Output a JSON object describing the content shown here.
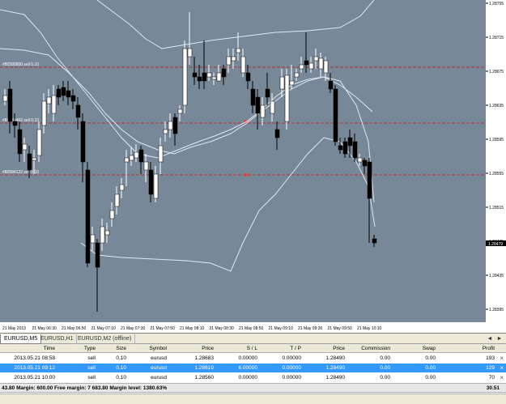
{
  "chart": {
    "background": "#778899",
    "candle_up": "#ffffff",
    "candle_down": "#000000",
    "band_color": "#e0e8f0",
    "order_line_color": "#b03030",
    "price_labels": [
      "1.28755",
      "1.28715",
      "1.28675",
      "1.28635",
      "1.28595",
      "1.28555",
      "1.28515",
      "1.28475",
      "1.28435",
      "1.28395"
    ],
    "current_price": "1.28479",
    "order_labels": [
      {
        "label": "#80580860 sell 0.10"
      },
      {
        "label": "#80584462 sell 0.10"
      },
      {
        "label": "#80584122 sell 0.10"
      }
    ],
    "time_labels": [
      "21 May 2013",
      "21 May 06:30",
      "21 May 06:50",
      "21 May 07:10",
      "21 May 07:30",
      "21 May 07:50",
      "21 May 08:10",
      "21 May 08:30",
      "21 May 08:50",
      "21 May 09:10",
      "21 May 09:30",
      "21 May 09:50",
      "21 May 10:10"
    ]
  },
  "tabs": [
    {
      "label": "EURUSD,M5"
    },
    {
      "label": "EURUSD,H1"
    },
    {
      "label": "EURUSD,M2 (offline)"
    }
  ],
  "tab_scroll": {
    "left": "◄",
    "right": "►"
  },
  "table": {
    "headers": {
      "time": "Time",
      "type": "Type",
      "size": "Size",
      "symbol": "Symbol",
      "price": "Price",
      "sl": "S / L",
      "tp": "T / P",
      "cur_price": "Price",
      "commission": "Commission",
      "swap": "Swap",
      "profit": "Profit"
    },
    "rows": [
      {
        "time": "2013.05.21 08:58",
        "type": "sell",
        "size": "0.10",
        "symbol": "eurusd",
        "price": "1.28683",
        "sl": "0.00000",
        "tp": "0.00000",
        "cur_price": "1.28490",
        "commission": "0.00",
        "swap": "0.00",
        "profit": "193",
        "close": "×"
      },
      {
        "time": "2013.05.21 09:12",
        "type": "sell",
        "size": "0.10",
        "symbol": "eurusd",
        "price": "1.28619",
        "sl": "6.00000",
        "tp": "0.00000",
        "cur_price": "1.28490",
        "commission": "0.00",
        "swap": "0.00",
        "profit": "129",
        "close": "×"
      },
      {
        "time": "2013.05.21 10:00",
        "type": "sell",
        "size": "0.10",
        "symbol": "eurusd",
        "price": "1.28560",
        "sl": "0.00000",
        "tp": "0.00000",
        "cur_price": "1.28490",
        "commission": "0.00",
        "swap": "0.00",
        "profit": "70",
        "close": "×"
      }
    ]
  },
  "summary": {
    "text": "43.80  Margin: 600.00  Free margin: 7 683.80  Margin level: 1380.63%",
    "total": "30.51"
  }
}
